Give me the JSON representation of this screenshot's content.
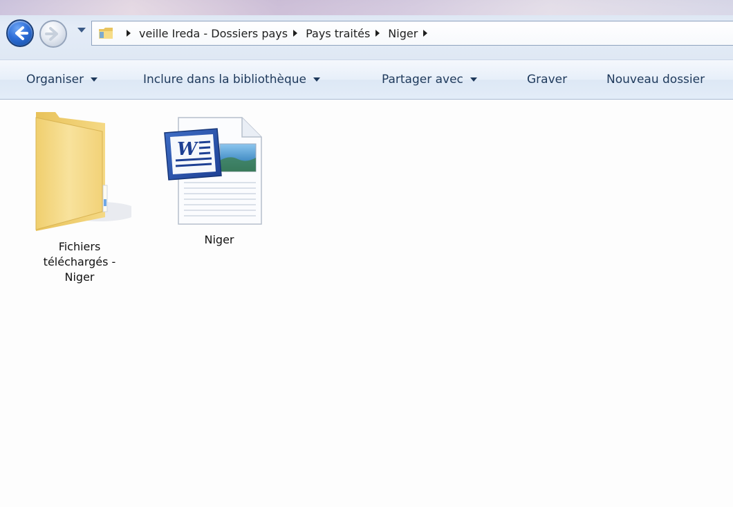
{
  "navigation": {
    "back_icon": "back-arrow-icon",
    "forward_icon": "forward-arrow-icon",
    "recent_icon": "chevron-down-icon"
  },
  "address_bar": {
    "folder_icon": "folder-icon",
    "crumbs": [
      "veille Ireda - Dossiers pays",
      "Pays traités",
      "Niger"
    ]
  },
  "commands": {
    "organize": "Organiser",
    "include_library": "Inclure dans la bibliothèque",
    "share_with": "Partager avec",
    "burn": "Graver",
    "new_folder": "Nouveau dossier"
  },
  "items": [
    {
      "type": "folder",
      "icon": "folder-icon",
      "label_lines": [
        "Fichiers",
        "téléchargés -",
        "Niger"
      ]
    },
    {
      "type": "word-document",
      "icon": "word-document-icon",
      "label_lines": [
        "Niger"
      ]
    }
  ],
  "colors": {
    "command_text": "#1e395b",
    "back_button": "#2e6ed8",
    "folder_yellow": "#f4d77a"
  }
}
